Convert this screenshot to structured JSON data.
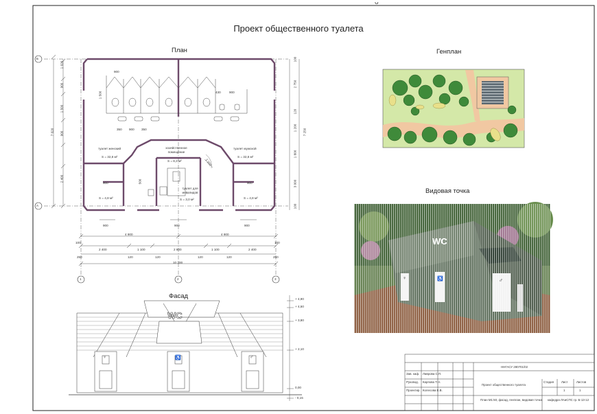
{
  "sheet": {
    "title": "Проект общественного туалета",
    "top_mark": "ᴗ"
  },
  "plan": {
    "title": "План",
    "axes_letters": [
      "Б",
      "А"
    ],
    "axes_numbers": [
      "1",
      "2",
      "3"
    ],
    "rooms": [
      {
        "name": "туалет женский",
        "area": "S = 32,8 м²"
      },
      {
        "name": "хозяйственное помещение",
        "area": "S = 8,3 м²"
      },
      {
        "name": "туалет мужской",
        "area": "S = 32,8 м²"
      },
      {
        "name": "туалет для инвалидов",
        "area": "S = 3,0 м²"
      },
      {
        "name": "",
        "area": "S = 4,8 м²"
      },
      {
        "name": "",
        "area": "S = 4,8 м²"
      }
    ],
    "dims_left": [
      "1 020",
      "900",
      "1 500",
      "900",
      "7 020",
      "2 400"
    ],
    "dims_right": [
      "100",
      "2 750",
      "120",
      "7 250",
      "1 200",
      "1 800",
      "3 000",
      "100"
    ],
    "dims_inner": [
      "900",
      "1 500",
      "900",
      "900",
      "350",
      "900",
      "350",
      "430",
      "900",
      "900",
      "900",
      "900",
      "900",
      "1 200",
      "500"
    ],
    "dims_bottom_row1": [
      "4 900",
      "4 900"
    ],
    "dims_bottom_row2": [
      "100",
      "2 400",
      "1 100",
      "2 800",
      "1 100",
      "2 400",
      "100"
    ],
    "dims_bottom_row3": [
      "250",
      "120",
      "120",
      "120",
      "120",
      "250"
    ],
    "dims_bottom_total": "10 300"
  },
  "genplan": {
    "title": "Генплан"
  },
  "view": {
    "title": "Видовая точка",
    "sign": "WC"
  },
  "facade": {
    "title": "Фасад",
    "sign": "WC",
    "levels": [
      "+ 4,90",
      "+ 4,50",
      "+ 3,80",
      "+ 2,10",
      "0,00",
      "- 0,15"
    ]
  },
  "stamp": {
    "code": "ННГАСУ 280701/02",
    "roles": [
      "Зав. каф.",
      "Руковод.",
      "Проектир."
    ],
    "names": [
      "Лаврова С.П.",
      "Карпова Т.Н.",
      "Колесова Е.В."
    ],
    "project": "Проект общественного туалета",
    "sheet_desc": "План М1:50, фасад, генплан, видовая точка",
    "col_heads": [
      "Стадия",
      "Лист",
      "Листов"
    ],
    "col_vals": [
      "",
      "1",
      "1"
    ],
    "org": "кафедра ЛАиСПС гр. Б-13-12"
  }
}
